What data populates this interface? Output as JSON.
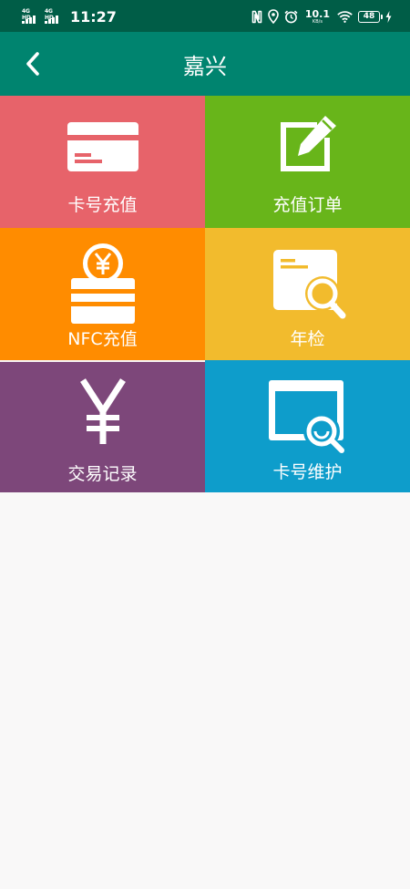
{
  "status_bar": {
    "signal_1_label": "4G HD",
    "signal_2_label": "4G HD",
    "time": "11:27",
    "icons": [
      "nfc-icon",
      "location-icon",
      "alarm-icon"
    ],
    "net_speed_value": "10.1",
    "net_speed_unit": "KB/s",
    "battery_level": "48"
  },
  "app_bar": {
    "back_icon": "chevron-left-icon",
    "title": "嘉兴"
  },
  "tiles": [
    {
      "label": "卡号充值",
      "icon": "card-icon",
      "color": "#e7636a"
    },
    {
      "label": "充值订单",
      "icon": "edit-order-icon",
      "color": "#68b51a"
    },
    {
      "label": "NFC充值",
      "icon": "yuan-coin-card-icon",
      "color": "#ff8c00"
    },
    {
      "label": "年检",
      "icon": "search-card-icon",
      "color": "#f2bb2d"
    },
    {
      "label": "交易记录",
      "icon": "yuan-icon",
      "color": "#7d477a"
    },
    {
      "label": "卡号维护",
      "icon": "search-window-icon",
      "color": "#0e9dcb"
    }
  ],
  "colors": {
    "status_bar": "#005d47",
    "app_bar": "#00846f",
    "background": "#f9f8f8"
  }
}
